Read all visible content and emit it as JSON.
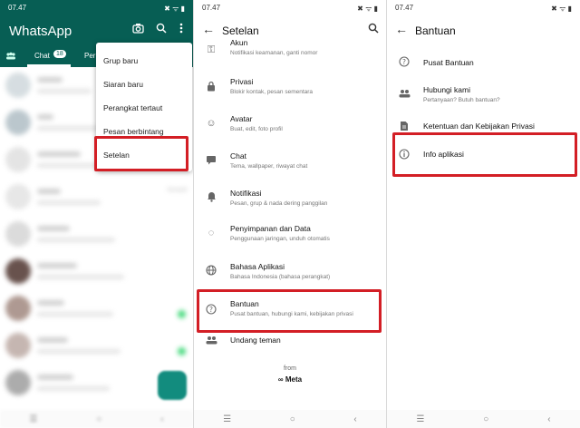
{
  "panel1": {
    "status_time": "07.47",
    "status_icons": "✖ ᯤ ▮",
    "app_title": "WhatsApp",
    "tab_chat": "Chat",
    "tab_badge": "18",
    "tab_next": "Per",
    "menu_items": [
      "Grup baru",
      "Siaran baru",
      "Perangkat tertaut",
      "Pesan berbintang",
      "Setelan"
    ],
    "chat_time_label": "Kemarin"
  },
  "panel2": {
    "status_time": "07.47",
    "status_icons": "✖ ᯤ ▮",
    "title": "Setelan",
    "items": [
      {
        "title": "Akun",
        "subtitle": "Notifikasi keamanan, ganti nomor"
      },
      {
        "title": "Privasi",
        "subtitle": "Blokir kontak, pesan sementara"
      },
      {
        "title": "Avatar",
        "subtitle": "Buat, edit, foto profil"
      },
      {
        "title": "Chat",
        "subtitle": "Tema, wallpaper, riwayat chat"
      },
      {
        "title": "Notifikasi",
        "subtitle": "Pesan, grup & nada dering panggilan"
      },
      {
        "title": "Penyimpanan dan Data",
        "subtitle": "Penggunaan jaringan, unduh otomatis"
      },
      {
        "title": "Bahasa Aplikasi",
        "subtitle": "Bahasa Indonesia (bahasa perangkat)"
      },
      {
        "title": "Bantuan",
        "subtitle": "Pusat bantuan, hubungi kami, kebijakan privasi"
      },
      {
        "title": "Undang teman",
        "subtitle": ""
      }
    ],
    "from_label": "from",
    "meta_label": "∞ Meta"
  },
  "panel3": {
    "status_time": "07.47",
    "status_icons": "✖ ᯤ ▮",
    "title": "Bantuan",
    "items": [
      {
        "title": "Pusat Bantuan",
        "subtitle": ""
      },
      {
        "title": "Hubungi kami",
        "subtitle": "Pertanyaan? Butuh bantuan?"
      },
      {
        "title": "Ketentuan dan Kebijakan Privasi",
        "subtitle": ""
      },
      {
        "title": "Info aplikasi",
        "subtitle": ""
      }
    ]
  },
  "colors": {
    "brand": "#075e54",
    "highlight": "#d31e25"
  }
}
